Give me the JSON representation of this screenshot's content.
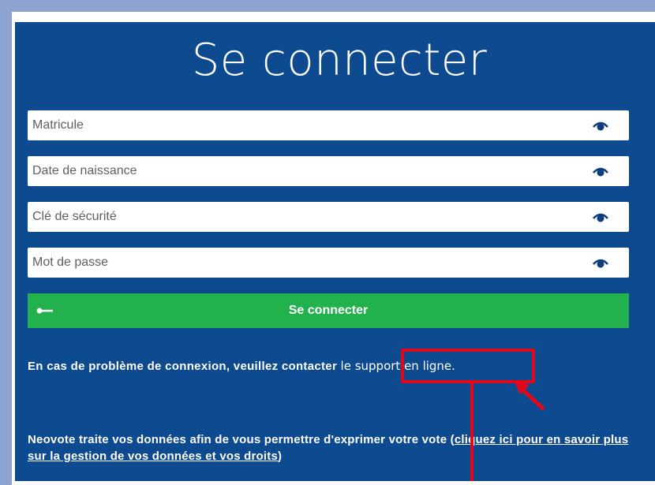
{
  "page": {
    "title": "Se connecter"
  },
  "form": {
    "fields": [
      {
        "placeholder": "Matricule",
        "value": "",
        "icon": "eye-icon"
      },
      {
        "placeholder": "Date de naissance",
        "value": "",
        "icon": "eye-icon"
      },
      {
        "placeholder": "Clé de sécurité",
        "value": "",
        "icon": "eye-icon"
      },
      {
        "placeholder": "Mot de passe",
        "value": "",
        "icon": "eye-icon"
      }
    ],
    "submit_label": "Se connecter",
    "submit_icon": "key-icon"
  },
  "help": {
    "text": "En cas de problème de connexion, veuillez contacter ",
    "link_label": "le support en ligne",
    "suffix": "."
  },
  "privacy": {
    "text": "Neovote traite vos données afin de vous permettre d'exprimer votre vote (",
    "link_label": "cliquez ici pour en savoir plus sur la gestion de vos données et vos droits",
    "suffix": ")"
  },
  "colors": {
    "background": "#8fa3d2",
    "panel": "#0d4a8f",
    "button": "#23b14d",
    "annotation": "#e3071b"
  }
}
